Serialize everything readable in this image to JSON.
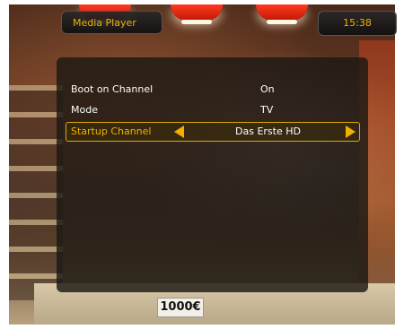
{
  "header": {
    "title": "Media Player",
    "clock": "15:38"
  },
  "menu": {
    "items": [
      {
        "label": "Boot on Channel",
        "value": "On"
      },
      {
        "label": "Mode",
        "value": "TV"
      },
      {
        "label": "Startup Channel",
        "value": "Das Erste HD"
      }
    ],
    "selected_index": 2
  },
  "background": {
    "sign_text": "1000€"
  },
  "colors": {
    "accent": "#f0b000",
    "panel": "#1c1814"
  }
}
